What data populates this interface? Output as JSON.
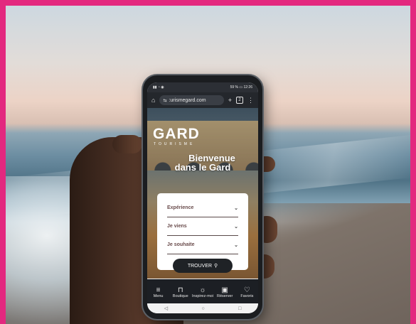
{
  "browser": {
    "url": ":urismegard.com",
    "tab_count": "2",
    "status_time": "12:26",
    "status_battery": "59 %"
  },
  "hero": {
    "logo": "GARD",
    "logo_sub": "TOURISME",
    "welcome_line1": "Bienvenue",
    "welcome_line2": "dans le Gard"
  },
  "form": {
    "fields": [
      {
        "label": "Expérience"
      },
      {
        "label": "Je viens"
      },
      {
        "label": "Je souhaite"
      }
    ],
    "submit_label": "TROUVER"
  },
  "bottom_nav": {
    "items": [
      {
        "label": "Menu",
        "icon": "menu-icon"
      },
      {
        "label": "Boutique",
        "icon": "basket-icon"
      },
      {
        "label": "Inspirez-moi",
        "icon": "idea-icon"
      },
      {
        "label": "Réserver",
        "icon": "calendar-icon"
      },
      {
        "label": "Favoris",
        "icon": "heart-icon"
      }
    ]
  },
  "colors": {
    "border": "#e3287f",
    "nav_bg": "#1c1f24",
    "card_bg": "#ffffff"
  }
}
